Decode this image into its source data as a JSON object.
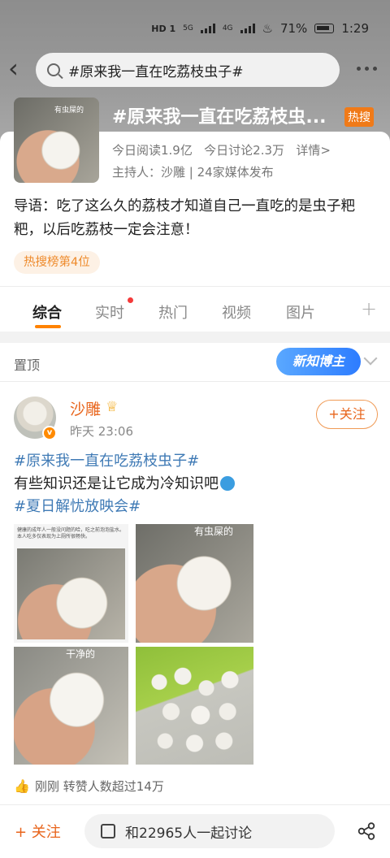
{
  "status_bar": {
    "network": "HD 1",
    "signal1": "5G",
    "signal2": "4G",
    "battery": "71%",
    "time": "1:29"
  },
  "search": {
    "query": "#原来我一直在吃荔枝虫子#"
  },
  "topic": {
    "title": "#原来我一直在吃荔枝虫...",
    "badge": "热搜",
    "thumb_label": "有虫屎的",
    "reads": "今日阅读1.9亿",
    "discussions": "今日讨论2.3万",
    "details": "详情>",
    "host": "主持人：沙雕 | 24家媒体发布",
    "intro": "导语：吃了这么久的荔枝才知道自己一直吃的是虫子粑粑，以后吃荔枝一定会注意！",
    "rank": "热搜榜第4位"
  },
  "tabs": [
    "综合",
    "实时",
    "热门",
    "视频",
    "图片"
  ],
  "pinned": {
    "label": "置顶",
    "badge": "新知博主"
  },
  "post": {
    "author": "沙雕",
    "time": "昨天 23:06",
    "follow": "+关注",
    "tag1": "#原来我一直在吃荔枝虫子#",
    "line2": "有些知识还是让它成为冷知识吧",
    "tag2": "#夏日解忧放映会#",
    "img1_caption": "健康的成年人一般没问题的哈，吃之前泡泡盐水。本人吃多仅表现为上厕所很畅快。",
    "img2_label": "有虫屎的",
    "img3_label": "干净的",
    "reposts": "刚刚 转赞人数超过14万"
  },
  "bottom_bar": {
    "follow": "+ 关注",
    "discuss": "和22965人一起讨论"
  }
}
